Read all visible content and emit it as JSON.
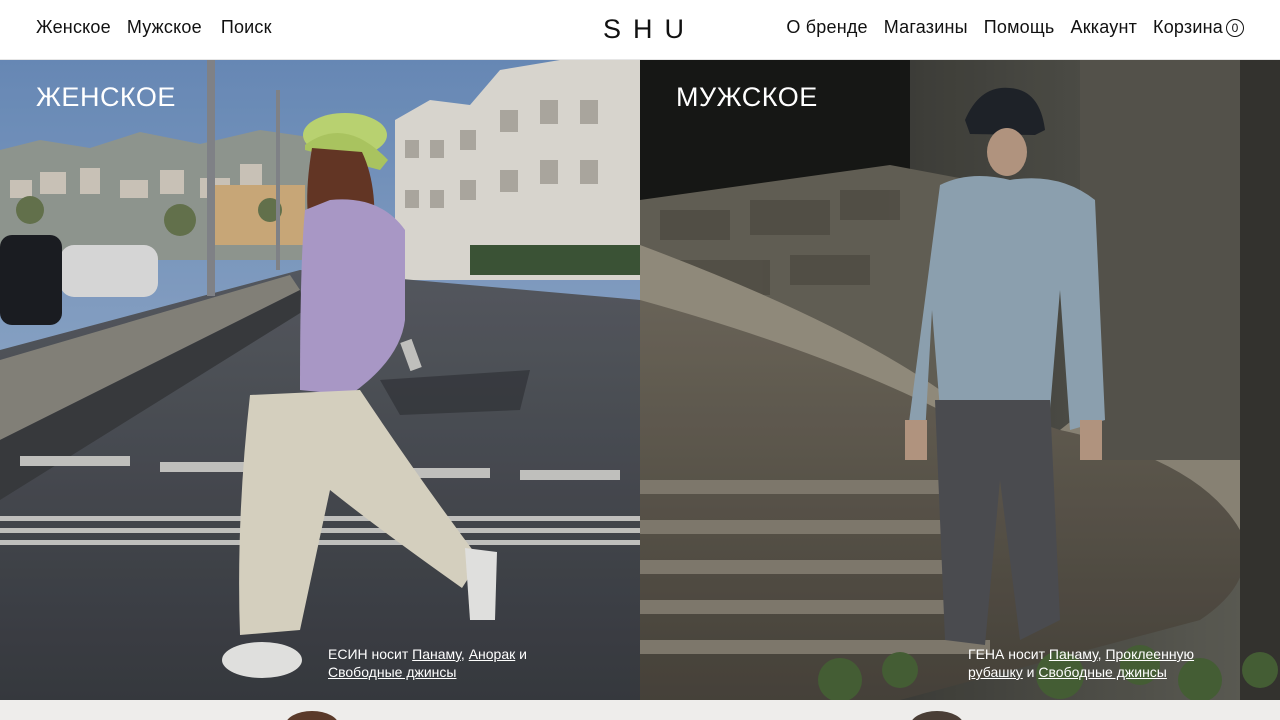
{
  "brand": {
    "logo": "SHU"
  },
  "nav": {
    "left": [
      "Женское",
      "Мужское",
      "Поиск"
    ],
    "right": [
      "О бренде",
      "Магазины",
      "Помощь",
      "Аккаунт"
    ],
    "cart_label": "Корзина",
    "cart_count": "0"
  },
  "panels": {
    "women": {
      "title": "ЖЕНСКОЕ",
      "caption": {
        "prefix": "ЕСИН носит ",
        "link1": "Панаму",
        "sep1": ", ",
        "link2": "Анорак",
        "sep2": " и ",
        "link3": "Свободные джинсы"
      }
    },
    "men": {
      "title": "МУЖСКОЕ",
      "caption": {
        "prefix": "ГЕНА носит ",
        "link1": "Панаму",
        "sep1": ", ",
        "link2": "Проклеенную рубашку",
        "sep2": " и ",
        "link3": "Свободные джинсы"
      }
    }
  },
  "colors": {
    "header_bg": "#ffffff",
    "text": "#111111",
    "overlay_text": "#ffffff",
    "bottom_strip": "#eeedeb"
  }
}
